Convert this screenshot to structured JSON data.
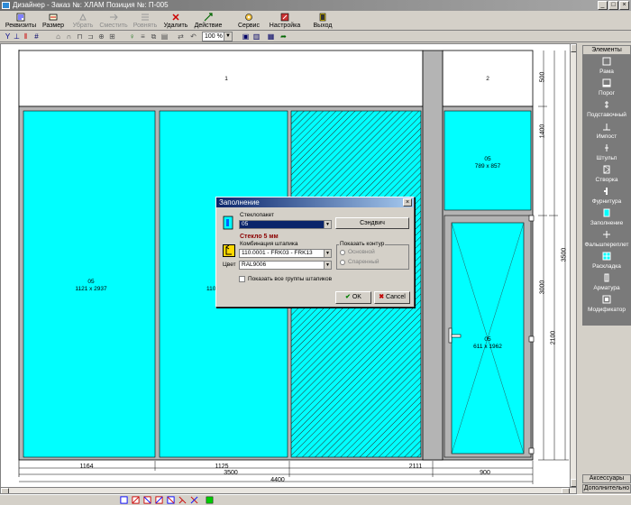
{
  "window": {
    "title": "Дизайнер - Заказ №: ХЛАМ Позиция №: П-005",
    "min": "_",
    "max": "□",
    "close": "×"
  },
  "toolbar": {
    "items": [
      {
        "label": "Реквизиты",
        "enabled": true
      },
      {
        "label": "Размер",
        "enabled": true
      },
      {
        "label": "Убрать",
        "enabled": false
      },
      {
        "label": "Сместить",
        "enabled": false
      },
      {
        "label": "Ровнять",
        "enabled": false
      },
      {
        "label": "Удалить",
        "enabled": true
      },
      {
        "label": "Действие",
        "enabled": true
      },
      {
        "label": "Сервис",
        "enabled": true
      },
      {
        "label": "Настройка",
        "enabled": true
      },
      {
        "label": "Выход",
        "enabled": true
      }
    ]
  },
  "toolbar2": {
    "zoom": "100 %"
  },
  "drawing": {
    "transom_left": "1",
    "transom_right": "2",
    "panes": [
      {
        "type": "05",
        "size": "1121 x 2937"
      },
      {
        "type": "05",
        "size": "789 x 857"
      },
      {
        "type": "05",
        "size": "611 x 1962"
      }
    ],
    "partial_label": "110",
    "bottom_dims": {
      "seg1": "1164",
      "seg2": "1125",
      "seg3": "2111",
      "d3500": "3500",
      "d900": "900",
      "d4400": "4400"
    },
    "right_dims": {
      "d500": "500",
      "d1400": "1400",
      "d3500": "3500",
      "d3000": "3000",
      "d2100": "2100"
    }
  },
  "panel": {
    "header": "Элементы",
    "items": [
      {
        "label": "Рама",
        "icon": "frame-icon"
      },
      {
        "label": "Порог",
        "icon": "threshold-icon"
      },
      {
        "label": "Подставочный",
        "icon": "stand-profile-icon"
      },
      {
        "label": "Импост",
        "icon": "mullion-icon"
      },
      {
        "label": "Штульп",
        "icon": "shtulp-icon"
      },
      {
        "label": "Створка",
        "icon": "sash-icon"
      },
      {
        "label": "Фурнитура",
        "icon": "hardware-icon"
      },
      {
        "label": "Заполнение",
        "icon": "fill-icon"
      },
      {
        "label": "Фальшпереплет",
        "icon": "false-bar-icon"
      },
      {
        "label": "Раскладка",
        "icon": "grid-icon"
      },
      {
        "label": "Арматура",
        "icon": "reinforcement-icon"
      },
      {
        "label": "Модификатор",
        "icon": "modifier-icon"
      }
    ],
    "footer1": "Аксессуары",
    "footer2": "Дополнительно"
  },
  "dialog": {
    "title": "Заполнение",
    "glass_label": "Стеклопакет",
    "glass_value": "05",
    "sandwich_button": "Сэндвич",
    "glass_info": "Стекло 5 мм",
    "bead_label": "Комбинация штапика",
    "bead_value": "110.0001 - FRK03 - FRK13",
    "color_label": "Цвет",
    "color_value": "RAL9006",
    "contour_label": "Показать контур",
    "radio_main": "Основной",
    "radio_paired": "Спаренный",
    "show_all_label": "Показать все группы штапиков",
    "ok": "OK",
    "cancel": "Cancel"
  },
  "colors": {
    "glass": "#00ffff",
    "frame": "#b4b4b4",
    "ok_check": "#008000",
    "cancel_x": "#c00000",
    "info_text": "#8b0000"
  }
}
